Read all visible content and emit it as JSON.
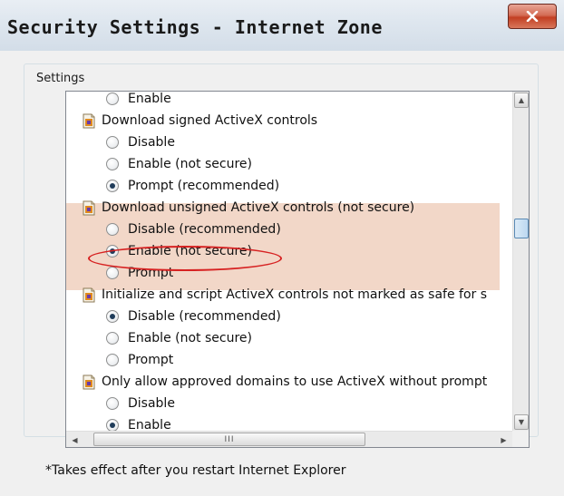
{
  "window": {
    "title": "Security Settings - Internet Zone",
    "close_label": "X"
  },
  "group": {
    "legend": "Settings"
  },
  "list": {
    "rows": [
      {
        "kind": "option",
        "label": "Enable",
        "checked": false
      },
      {
        "kind": "category",
        "label": "Download signed ActiveX controls",
        "icon": "settings-category-icon"
      },
      {
        "kind": "option",
        "label": "Disable",
        "checked": false
      },
      {
        "kind": "option",
        "label": "Enable (not secure)",
        "checked": false
      },
      {
        "kind": "option",
        "label": "Prompt (recommended)",
        "checked": true
      },
      {
        "kind": "category",
        "label": "Download unsigned ActiveX controls (not secure)",
        "icon": "settings-category-icon"
      },
      {
        "kind": "option",
        "label": "Disable (recommended)",
        "checked": false
      },
      {
        "kind": "option",
        "label": "Enable (not secure)",
        "checked": true
      },
      {
        "kind": "option",
        "label": "Prompt",
        "checked": false
      },
      {
        "kind": "category",
        "label": "Initialize and script ActiveX controls not marked as safe for s",
        "icon": "settings-category-icon"
      },
      {
        "kind": "option",
        "label": "Disable (recommended)",
        "checked": true
      },
      {
        "kind": "option",
        "label": "Enable (not secure)",
        "checked": false
      },
      {
        "kind": "option",
        "label": "Prompt",
        "checked": false
      },
      {
        "kind": "category",
        "label": "Only allow approved domains to use ActiveX without prompt",
        "icon": "settings-category-icon"
      },
      {
        "kind": "option",
        "label": "Disable",
        "checked": false
      },
      {
        "kind": "option",
        "label": "Enable",
        "checked": true
      }
    ],
    "hscroll_grip": "III"
  },
  "footnote": "*Takes effect after you restart Internet Explorer",
  "colors": {
    "highlight": "#f2d7c8",
    "annotation_circle": "#d72222"
  }
}
